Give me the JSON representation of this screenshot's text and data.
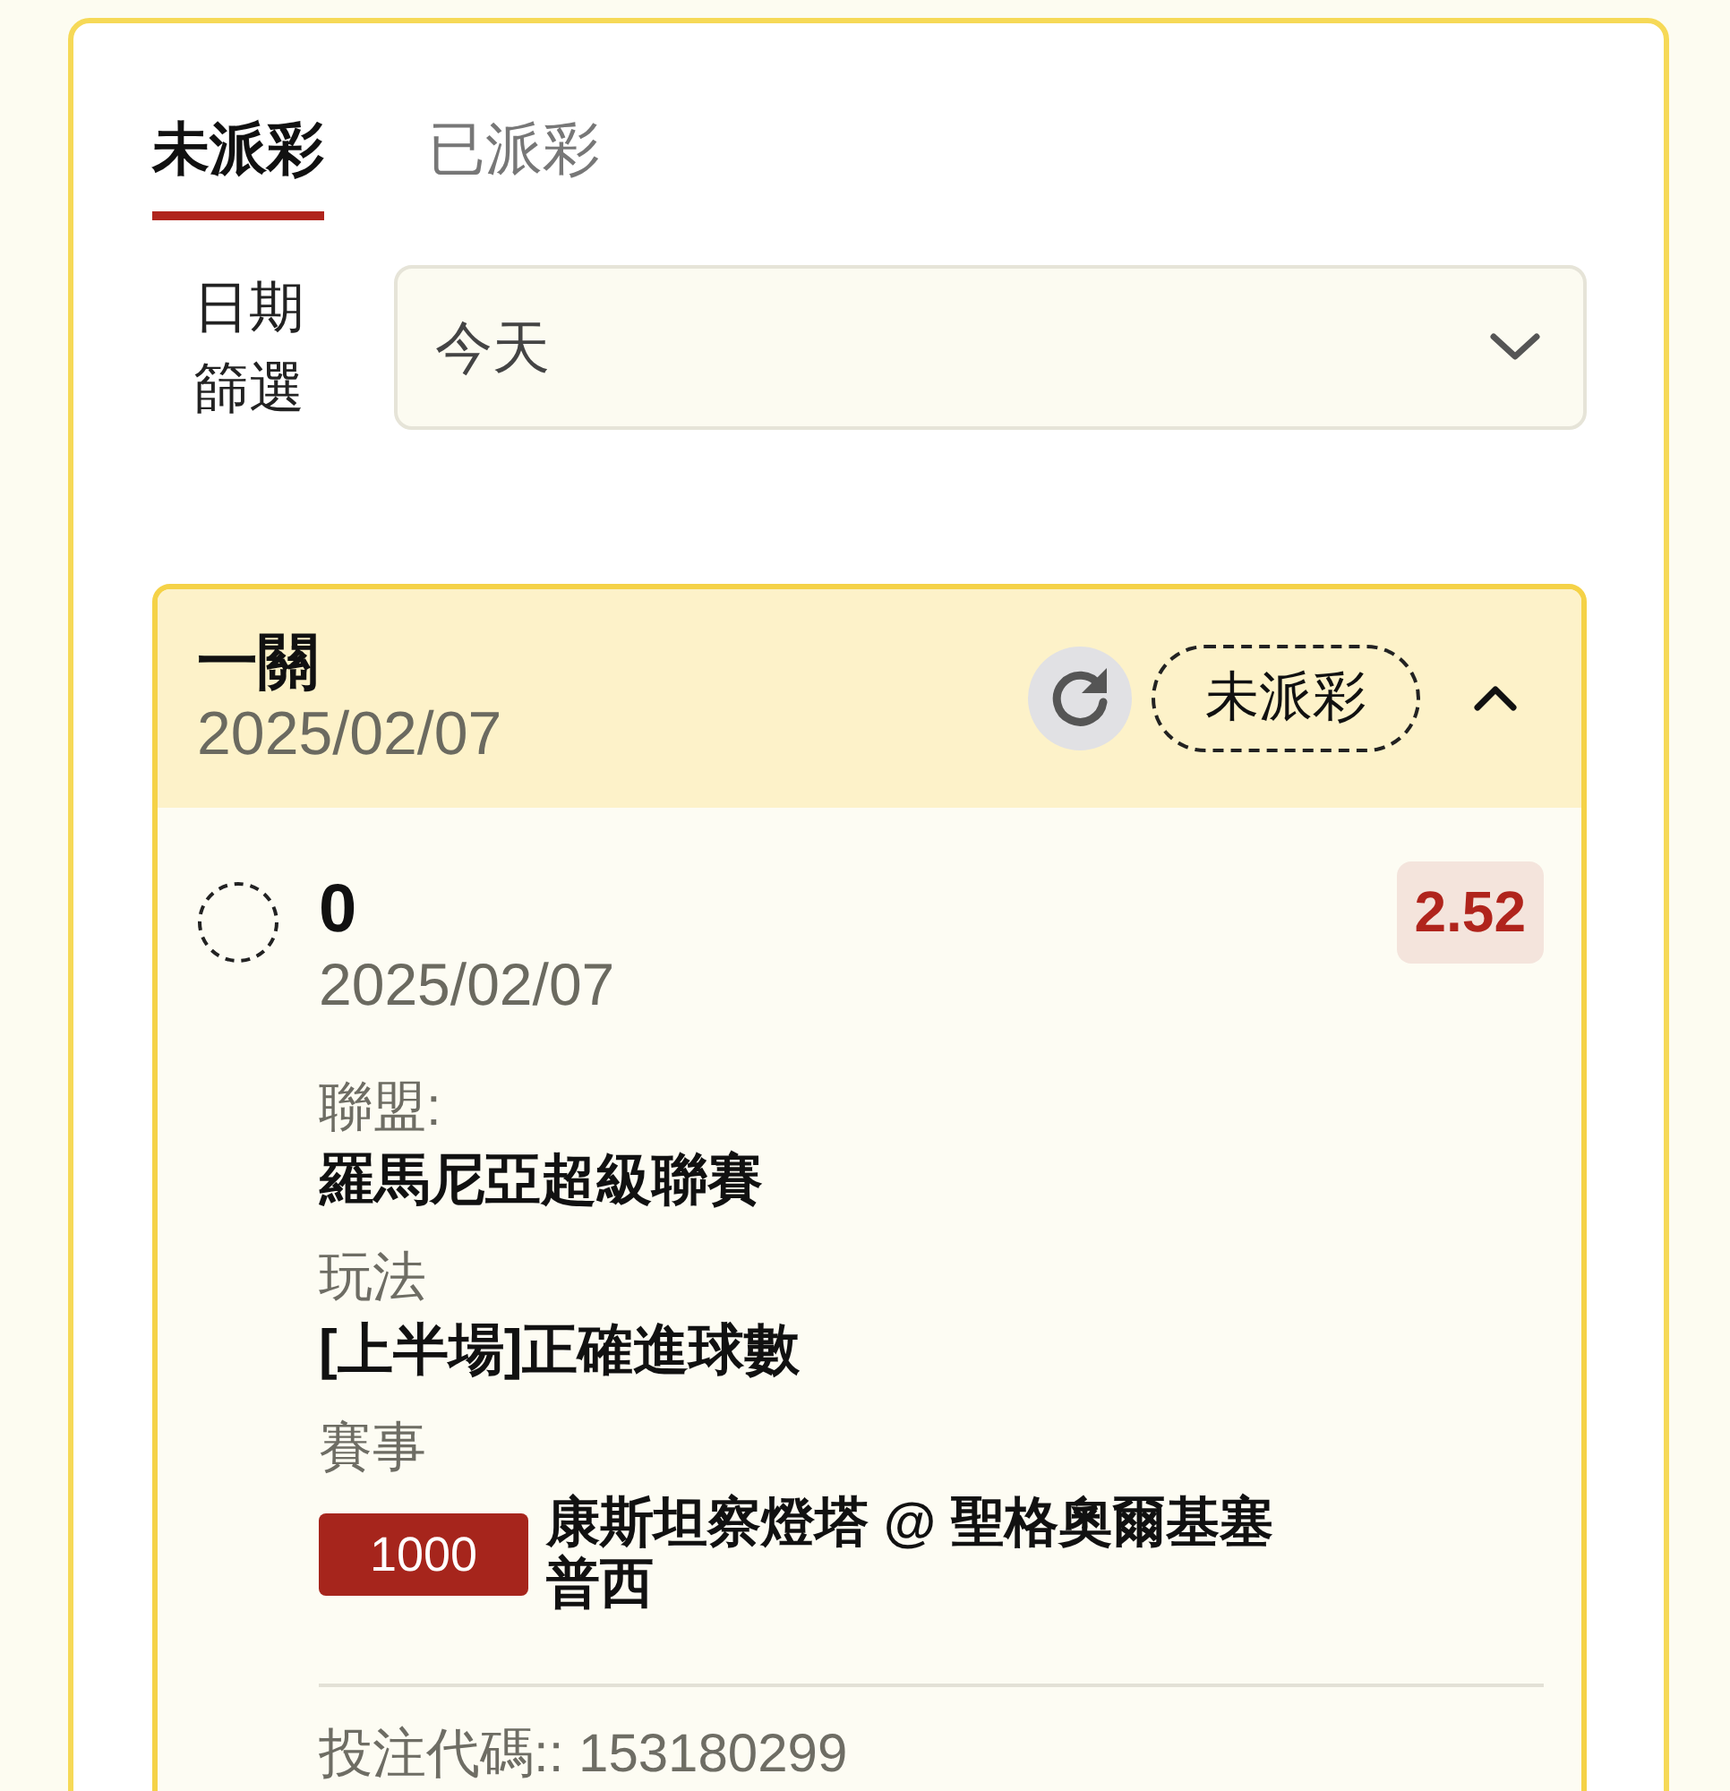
{
  "tabs": [
    {
      "label": "未派彩",
      "selected": true
    },
    {
      "label": "已派彩",
      "selected": false
    }
  ],
  "date_filter": {
    "label": "日期篩選",
    "value": "今天"
  },
  "bets": [
    {
      "type": "一關",
      "date": "2025/02/07",
      "status": "未派彩",
      "expanded": true,
      "selections": [
        {
          "pick": "0",
          "date": "2025/02/07",
          "odds": "2.52",
          "details": [
            {
              "kind": "text",
              "label": "聯盟:",
              "value": "羅馬尼亞超級聯賽"
            },
            {
              "kind": "text",
              "label": "玩法",
              "value": "[上半場]正確進球數"
            },
            {
              "kind": "match",
              "label": "賽事",
              "code": "1000",
              "value": "康斯坦察燈塔 @ 聖格奧爾基塞普西"
            }
          ]
        }
      ],
      "bet_code": "投注代碼:: 153180299"
    }
  ]
}
